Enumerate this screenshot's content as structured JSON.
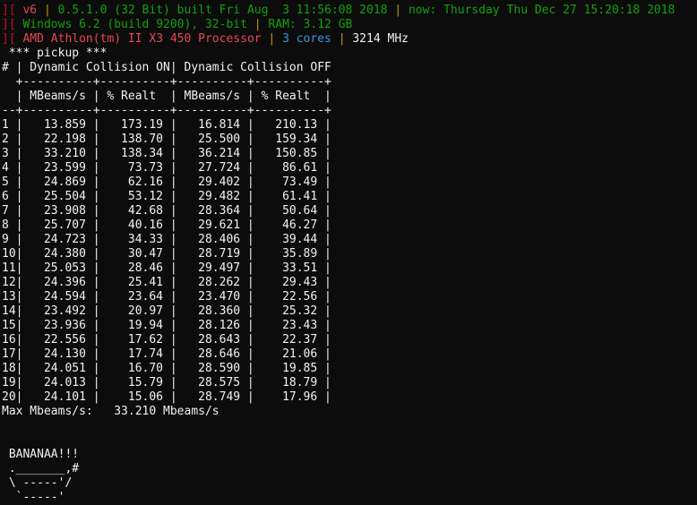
{
  "header": {
    "line1": {
      "bracket": "][",
      "version": "v6",
      "sep1": "|",
      "build": "0.5.1.0 (32 Bit) built Fri Aug  3 11:56:08 2018",
      "sep2": "|",
      "now": "now: Thursday Thu Dec 27 15:20:18 2018"
    },
    "line2": {
      "bracket": "][",
      "os": "Windows 6.2 (build 9200), 32-bit",
      "sep": "|",
      "ram": "RAM: 3.12 GB"
    },
    "line3": {
      "bracket": "][",
      "cpu": "AMD Athlon(tm) II X3 450 Processor",
      "sep1": "|",
      "cores": "3 cores",
      "sep2": "|",
      "mhz": "3214 MHz"
    }
  },
  "section_title": " *** pickup ***",
  "table": {
    "head1": "# | Dynamic Collision ON| Dynamic Collision OFF",
    "rule1": "  +----------+----------+----------+----------+",
    "head2": "  | MBeams/s | % Realt  | MBeams/s | % Realt  |",
    "rule2": "--+----------+----------+----------+----------+",
    "rows": [
      "1 |   13.859 |   173.19 |   16.814 |   210.13 |",
      "2 |   22.198 |   138.70 |   25.500 |   159.34 |",
      "3 |   33.210 |   138.34 |   36.214 |   150.85 |",
      "4 |   23.599 |    73.73 |   27.724 |    86.61 |",
      "5 |   24.869 |    62.16 |   29.402 |    73.49 |",
      "6 |   25.504 |    53.12 |   29.482 |    61.41 |",
      "7 |   23.908 |    42.68 |   28.364 |    50.64 |",
      "8 |   25.707 |    40.16 |   29.621 |    46.27 |",
      "9 |   24.723 |    34.33 |   28.406 |    39.44 |",
      "10|   24.380 |    30.47 |   28.719 |    35.89 |",
      "11|   25.053 |    28.46 |   29.497 |    33.51 |",
      "12|   24.396 |    25.41 |   28.262 |    29.43 |",
      "13|   24.594 |    23.64 |   23.470 |    22.56 |",
      "14|   23.492 |    20.97 |   28.360 |    25.32 |",
      "15|   23.936 |    19.94 |   28.126 |    23.43 |",
      "16|   22.556 |    17.62 |   28.643 |    22.37 |",
      "17|   24.130 |    17.74 |   28.646 |    21.06 |",
      "18|   24.051 |    16.70 |   28.590 |    19.85 |",
      "19|   24.013 |    15.79 |   28.575 |    18.79 |",
      "20|   24.101 |    15.06 |   28.749 |    17.96 |"
    ]
  },
  "max_line": "Max Mbeams/s:   33.210 Mbeams/s",
  "blank": "",
  "banana": [
    " BANANAA!!!",
    " ._______,#",
    " \\ -----'/",
    "  `-----'"
  ]
}
